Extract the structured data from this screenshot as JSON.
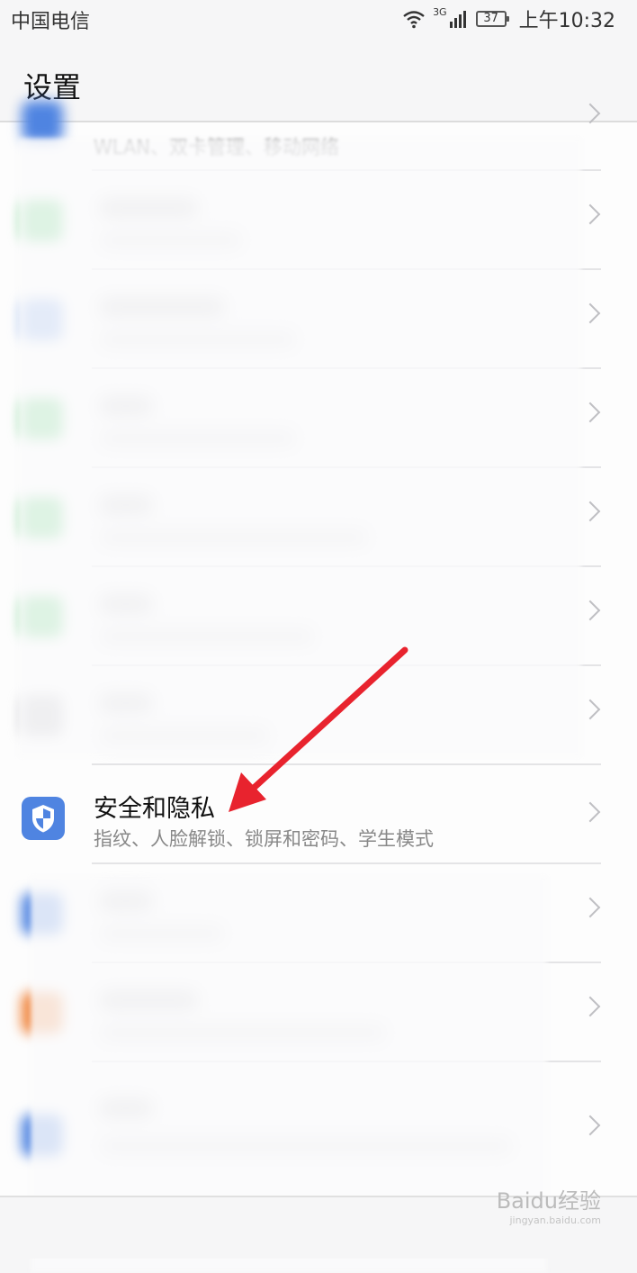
{
  "status_bar": {
    "carrier": "中国电信",
    "network": "3G",
    "battery": "37",
    "time": "上午10:32"
  },
  "header": {
    "title": "设置"
  },
  "top_partial_row": {
    "text": "WLAN、双卡管理、移动网络"
  },
  "focused_row": {
    "title": "安全和隐私",
    "subtitle": "指纹、人脸解锁、锁屏和密码、学生模式",
    "icon": "shield-icon",
    "icon_color": "#4f84e1"
  },
  "colors": {
    "accent": "#4f84e1",
    "arrow": "#e8232e",
    "green_icon": "#5fcf7a",
    "orange_icon": "#f0833a"
  },
  "watermark": {
    "text": "Baidu经验",
    "sub": "jingyan.baidu.com"
  }
}
